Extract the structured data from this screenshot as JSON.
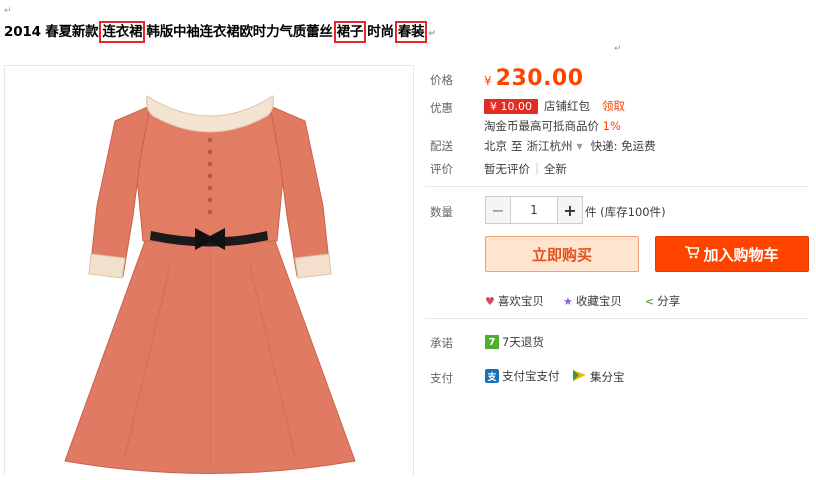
{
  "title": {
    "p1": "2014 春夏新款",
    "h1": "连衣裙",
    "p2": "韩版中袖连衣裙欧时力气质蕾丝",
    "h2": "裙子",
    "p3": "时尚",
    "h3": "春装"
  },
  "para_mark": "↵",
  "price": {
    "label": "价格",
    "currency": "¥",
    "amount": "230.00"
  },
  "promo": {
    "label": "优惠",
    "coupon": "¥ 10.00",
    "coupon_text": "店铺红包",
    "claim": "领取",
    "taojinbi": "淘金币最高可抵商品价",
    "taojinbi_pct": "1%"
  },
  "shipping": {
    "label": "配送",
    "from": "北京",
    "to_word": "至",
    "dest": "浙江杭州",
    "express": "快递: 免运费"
  },
  "review": {
    "label": "评价",
    "none": "暂无评价",
    "sep": "|",
    "newness": "全新"
  },
  "quantity": {
    "label": "数量",
    "minus": "−",
    "value": "1",
    "plus": "+",
    "unit": "件 (库存100件)"
  },
  "actions": {
    "buy_now": "立即购买",
    "add_to_cart": "加入购物车"
  },
  "social": {
    "like": "喜欢宝贝",
    "favorite": "收藏宝贝",
    "share": "分享"
  },
  "promise": {
    "label": "承诺",
    "badge": "7",
    "text": "7天退货"
  },
  "payment": {
    "label": "支付",
    "alipay": "支付宝支付",
    "jifenbao": "集分宝"
  },
  "colors": {
    "accent": "#ff4400",
    "highlight_box": "#e5262a",
    "dress": "#e07a62"
  }
}
